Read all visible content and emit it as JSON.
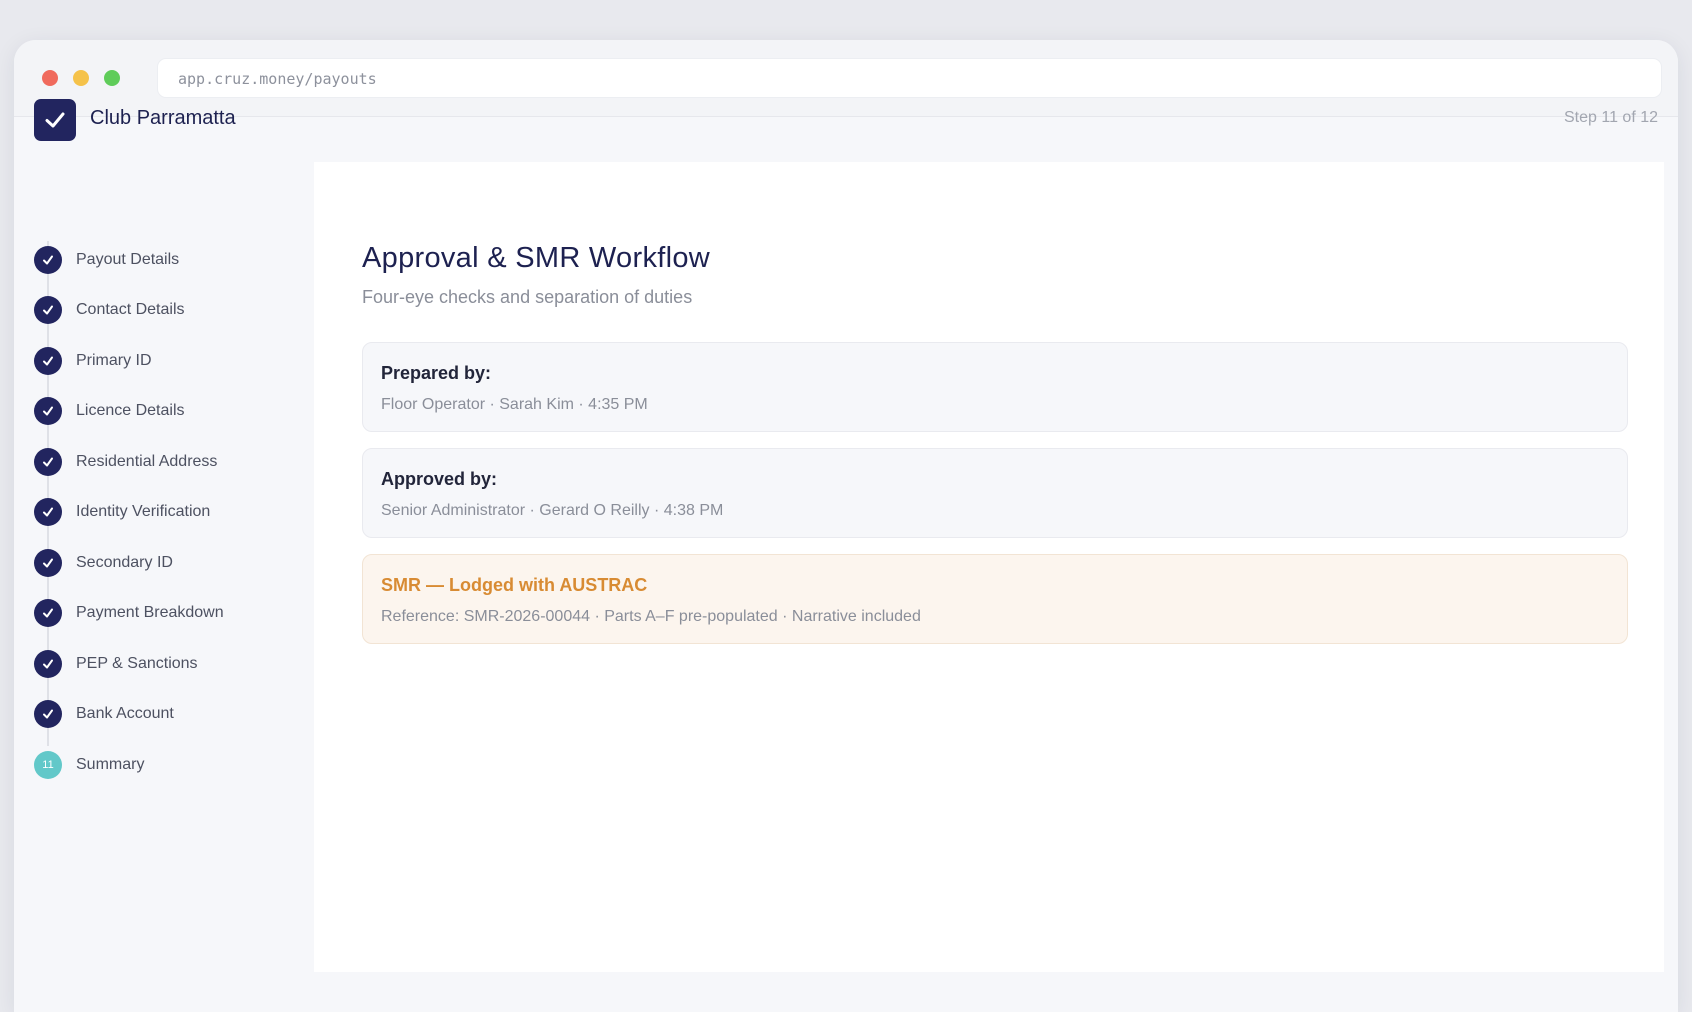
{
  "browser": {
    "url": "app.cruz.money/payouts"
  },
  "header": {
    "club_name": "Club Parramatta",
    "step_counter": "Step 11 of 12"
  },
  "sidebar": {
    "steps": [
      {
        "label": "Payout Details",
        "status": "complete"
      },
      {
        "label": "Contact Details",
        "status": "complete"
      },
      {
        "label": "Primary ID",
        "status": "complete"
      },
      {
        "label": "Licence Details",
        "status": "complete"
      },
      {
        "label": "Residential Address",
        "status": "complete"
      },
      {
        "label": "Identity Verification",
        "status": "complete"
      },
      {
        "label": "Secondary ID",
        "status": "complete"
      },
      {
        "label": "Payment Breakdown",
        "status": "complete"
      },
      {
        "label": "PEP & Sanctions",
        "status": "complete"
      },
      {
        "label": "Bank Account",
        "status": "complete"
      },
      {
        "label": "Summary",
        "status": "current",
        "number": "11"
      }
    ]
  },
  "main": {
    "title": "Approval & SMR Workflow",
    "subtitle": "Four-eye checks and separation of duties",
    "cards": [
      {
        "title": "Prepared by:",
        "detail": "Floor Operator · Sarah Kim · 4:35 PM"
      },
      {
        "title": "Approved by:",
        "detail": "Senior Administrator · Gerard O Reilly · 4:38 PM"
      },
      {
        "title": "SMR — Lodged with AUSTRAC",
        "detail": "Reference: SMR-2026-00044 · Parts A–F pre-populated · Narrative included"
      }
    ]
  },
  "colors": {
    "brand_navy": "#22255f",
    "current_step": "#62c8c9",
    "smr_accent": "#d88b33"
  }
}
